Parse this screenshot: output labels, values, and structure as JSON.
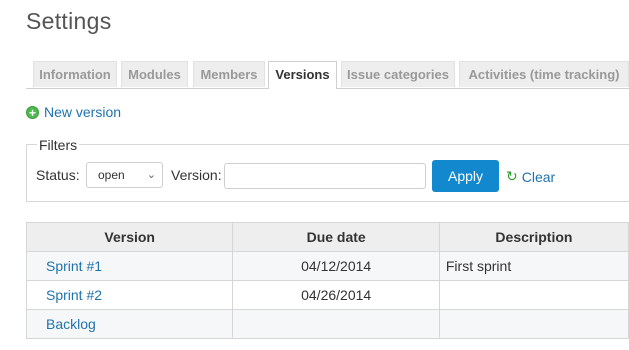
{
  "page": {
    "title": "Settings"
  },
  "tabs": [
    {
      "label": "Information",
      "active": false
    },
    {
      "label": "Modules",
      "active": false
    },
    {
      "label": "Members",
      "active": false
    },
    {
      "label": "Versions",
      "active": true
    },
    {
      "label": "Issue categories",
      "active": false
    },
    {
      "label": "Activities (time tracking)",
      "active": false
    }
  ],
  "actions": {
    "new_version": "New version"
  },
  "filters": {
    "legend": "Filters",
    "status_label": "Status:",
    "status_value": "open",
    "version_label": "Version:",
    "version_value": "",
    "apply_label": "Apply",
    "clear_label": "Clear"
  },
  "table": {
    "columns": [
      "Version",
      "Due date",
      "Description"
    ],
    "rows": [
      {
        "name": "Sprint #1",
        "due_date": "04/12/2014",
        "description": "First sprint"
      },
      {
        "name": "Sprint #2",
        "due_date": "04/26/2014",
        "description": ""
      },
      {
        "name": "Backlog",
        "due_date": "",
        "description": ""
      }
    ]
  },
  "colors": {
    "link": "#1f73ad",
    "apply_bg": "#1288cf",
    "tab_bg": "#eeeeee"
  }
}
